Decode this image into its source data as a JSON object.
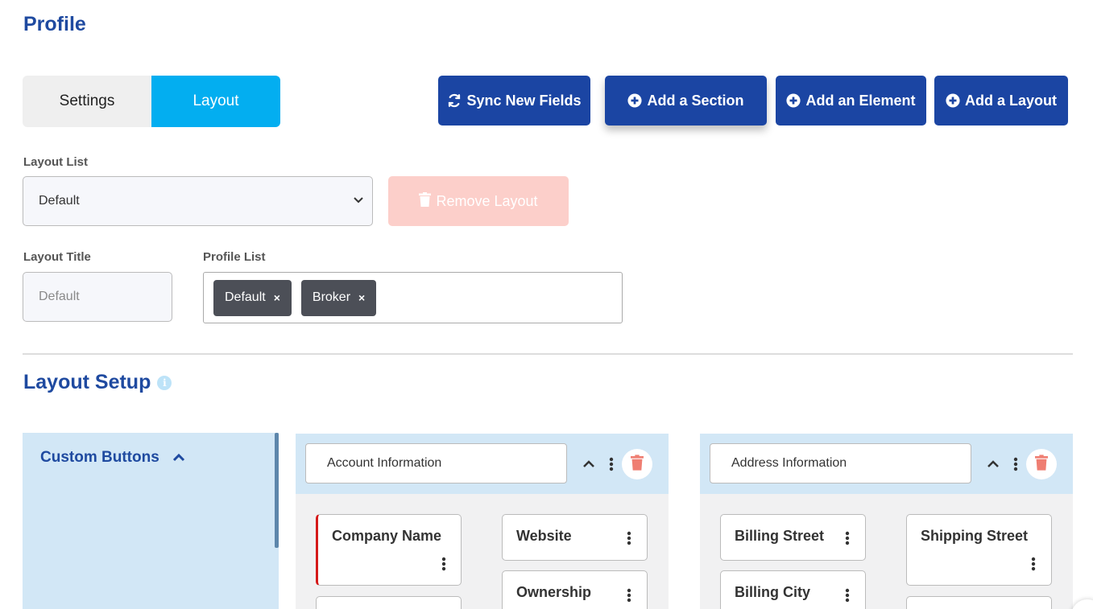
{
  "page": {
    "title": "Profile"
  },
  "tabs": [
    {
      "label": "Settings",
      "active": false
    },
    {
      "label": "Layout",
      "active": true
    }
  ],
  "actions": {
    "sync": "Sync New Fields",
    "add_section": "Add a Section",
    "add_element": "Add an Element",
    "add_layout": "Add a Layout"
  },
  "layout_list": {
    "label": "Layout List",
    "selected": "Default"
  },
  "remove_layout": {
    "label": "Remove Layout"
  },
  "layout_title": {
    "label": "Layout Title",
    "placeholder": "Default"
  },
  "profile_list": {
    "label": "Profile List",
    "tags": [
      "Default",
      "Broker"
    ]
  },
  "layout_setup": {
    "title": "Layout Setup",
    "info": "i"
  },
  "custom_buttons": {
    "title": "Custom Buttons"
  },
  "sections": [
    {
      "name": "Account Information",
      "elements": [
        "Company Name",
        "Website",
        "Ownership"
      ]
    },
    {
      "name": "Address Information",
      "elements": [
        "Billing Street",
        "Shipping Street",
        "Billing City"
      ]
    }
  ],
  "colors": {
    "primary": "#1b45a3",
    "title": "#1f4aa0",
    "tab_active": "#03aef0",
    "remove_disabled": "#fccfca",
    "panel_blue": "#d2e7f6",
    "required": "#d51a1a",
    "delete_icon": "#ef7e72"
  }
}
